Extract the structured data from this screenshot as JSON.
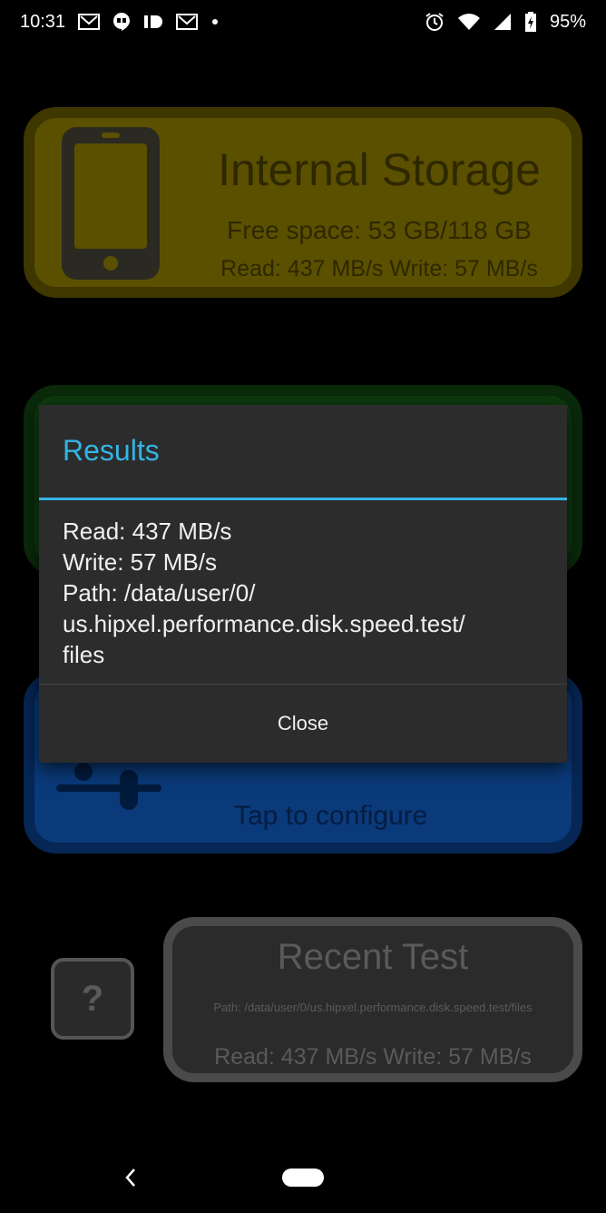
{
  "status_bar": {
    "time": "10:31",
    "battery": "95%",
    "icons_left": [
      "gmail-icon",
      "hangouts-icon",
      "id-icon",
      "mail-icon",
      "dot-icon"
    ],
    "icons_right": [
      "alarm-icon",
      "wifi-icon",
      "signal-icon",
      "battery-charging-icon"
    ]
  },
  "internal_card": {
    "title": "Internal Storage",
    "free_space": "Free space: 53 GB/118 GB",
    "read_write": "Read: 437 MB/s Write: 57 MB/s",
    "color": "#5b5000"
  },
  "configure_card": {
    "label": "Tap to configure",
    "color": "#0a3a7a"
  },
  "help": {
    "label": "?"
  },
  "recent_test": {
    "title": "Recent Test",
    "path": "Path: /data/user/0/us.hipxel.performance.disk.speed.test/files",
    "read_write": "Read: 437 MB/s Write: 57 MB/s"
  },
  "dialog": {
    "title": "Results",
    "lines": [
      "Read: 437 MB/s",
      "Write: 57 MB/s",
      "Path: /data/user/0/",
      "us.hipxel.performance.disk.speed.test/",
      "files"
    ],
    "close_label": "Close",
    "accent_color": "#33b5e5"
  }
}
